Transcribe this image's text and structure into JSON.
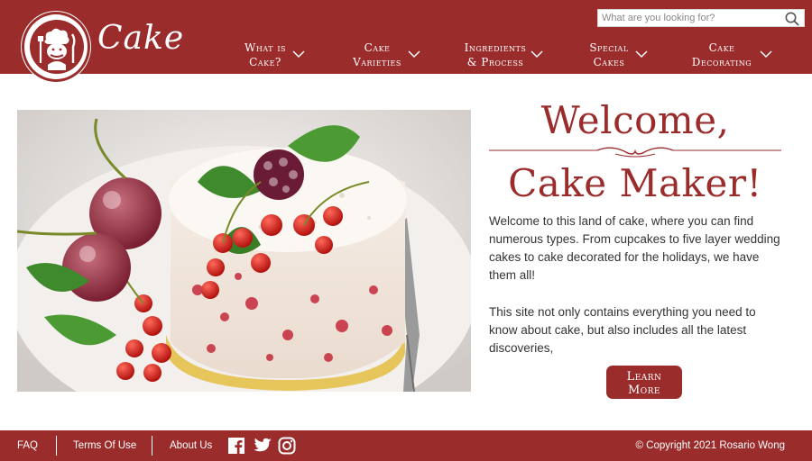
{
  "brand": {
    "name": "Cake"
  },
  "search": {
    "placeholder": "What are you looking for?",
    "value": ""
  },
  "nav": [
    {
      "line1": "What is",
      "line2": "Cake?"
    },
    {
      "line1": "Cake",
      "line2": "Varieties"
    },
    {
      "line1": "Ingredients",
      "line2": "& Process"
    },
    {
      "line1": "Special",
      "line2": "Cakes"
    },
    {
      "line1": "Cake",
      "line2": "Decorating"
    }
  ],
  "welcome": {
    "line1": "Welcome,",
    "line2": "Cake Maker!"
  },
  "intro": {
    "p1": "Welcome to this land of cake, where you can find numerous types. From cupcakes to five layer wedding cakes to cake decorated for the holidays, we have them all!",
    "p2": "This site not only contains everything you need to know about cake, but also includes all the latest discoveries,"
  },
  "cta": {
    "line1": "Learn",
    "line2": "More"
  },
  "footer": {
    "faq": "FAQ",
    "terms": "Terms Of Use",
    "about": "About Us",
    "copyright": "© Copyright 2021 Rosario Wong",
    "social": [
      "facebook-icon",
      "twitter-icon",
      "instagram-icon"
    ]
  },
  "colors": {
    "brand": "#9b2c2c",
    "text": "#333333",
    "background": "#ffffff"
  }
}
